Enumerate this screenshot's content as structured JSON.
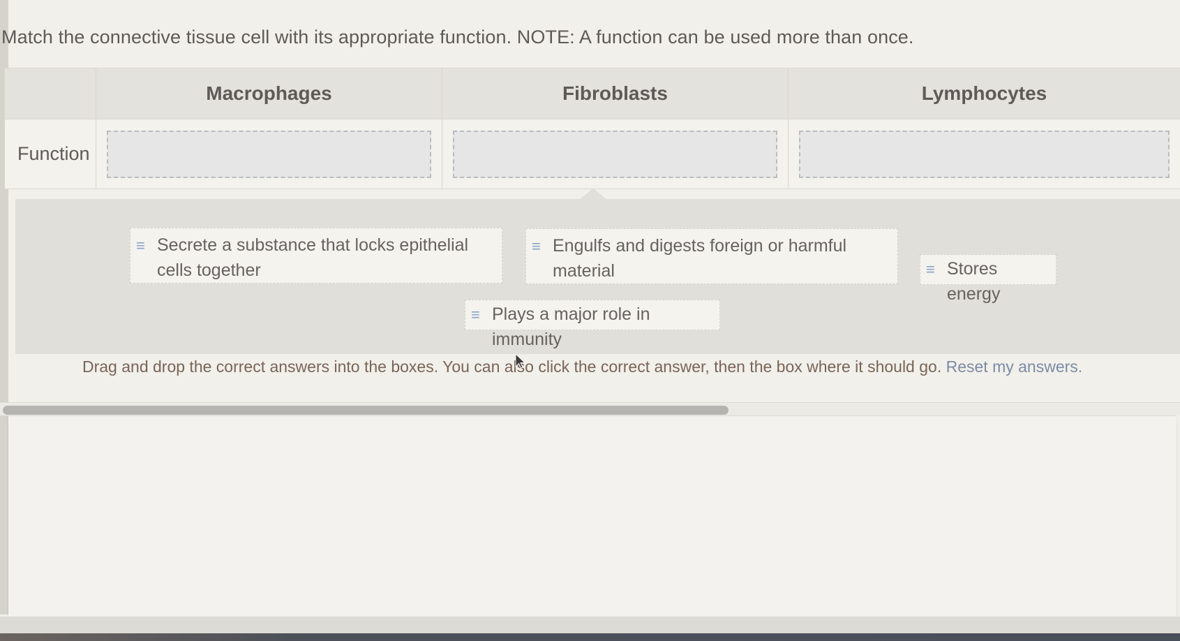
{
  "question": {
    "prompt": "Match the connective tissue cell with its appropriate function. NOTE: A function can be used more than once."
  },
  "table": {
    "columns": [
      "Macrophages",
      "Fibroblasts",
      "Lymphocytes"
    ],
    "row_label": "Function",
    "drop_zones": [
      "",
      "",
      ""
    ]
  },
  "answer_bank": {
    "items": [
      {
        "icon": "drag-handle-icon",
        "label": "Secrete a substance that locks epithelial cells together"
      },
      {
        "icon": "drag-handle-icon",
        "label": "Engulfs and digests foreign or harmful material"
      },
      {
        "icon": "drag-handle-icon",
        "label": "Stores energy"
      },
      {
        "icon": "drag-handle-icon",
        "label": "Plays a major role in immunity"
      }
    ]
  },
  "instructions": {
    "text": "Drag and drop the correct answers into the boxes. You can also click the correct answer, then the box where it should go.",
    "reset_link": "Reset my answers."
  },
  "icons": {
    "handle_glyph": "≡"
  },
  "colors": {
    "handle_accent": "#8aa3c8",
    "link": "#7c8ca6",
    "instruction_text": "#7a6458"
  }
}
